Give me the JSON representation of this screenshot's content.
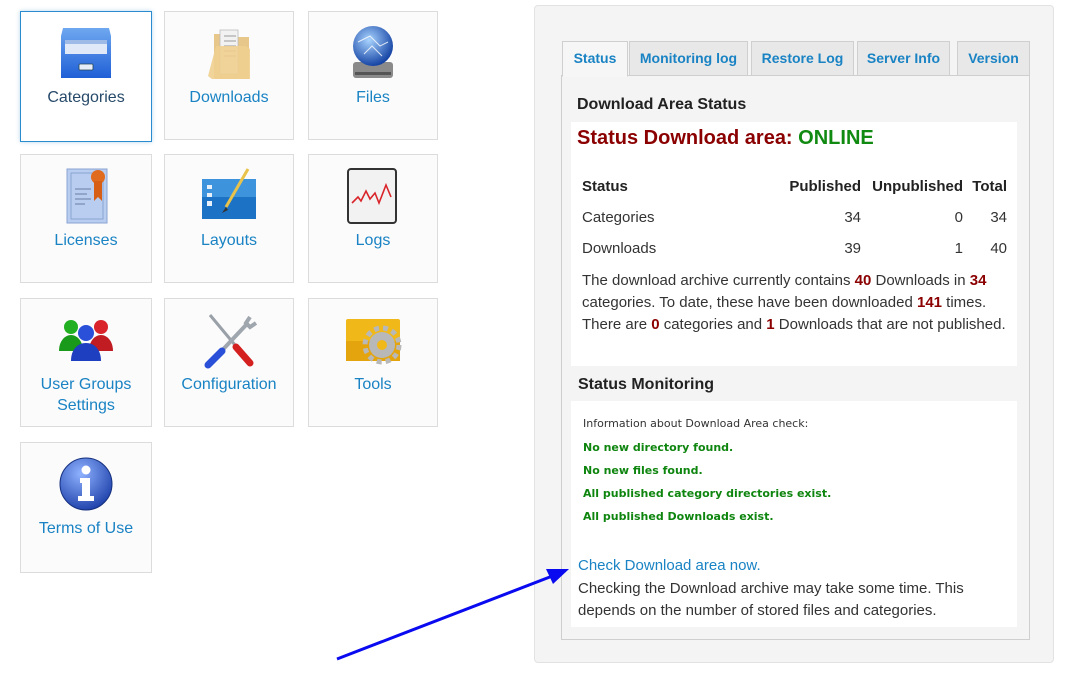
{
  "tiles": [
    {
      "label": "Categories",
      "icon": "file-cabinet-icon",
      "active": true
    },
    {
      "label": "Downloads",
      "icon": "folder-documents-icon"
    },
    {
      "label": "Files",
      "icon": "network-drive-globe-icon"
    },
    {
      "label": "Licenses",
      "icon": "certificate-icon"
    },
    {
      "label": "Layouts",
      "icon": "layout-brush-icon"
    },
    {
      "label": "Logs",
      "icon": "log-chart-icon"
    },
    {
      "label": "User Groups Settings",
      "label_line1": "User Groups",
      "label_line2": "Settings",
      "icon": "user-group-icon"
    },
    {
      "label": "Configuration",
      "icon": "tools-wrench-screwdriver-icon"
    },
    {
      "label": "Tools",
      "icon": "folder-gear-icon"
    },
    {
      "label": "Terms of Use",
      "icon": "info-icon"
    }
  ],
  "tabs": [
    {
      "label": "Status",
      "active": true
    },
    {
      "label": "Monitoring log"
    },
    {
      "label": "Restore Log"
    },
    {
      "label": "Server Info"
    },
    {
      "label": "Version"
    }
  ],
  "status": {
    "heading": "Download Area Status",
    "status_prefix": "Status Download area:",
    "status_value": "ONLINE",
    "table": {
      "headers": [
        "Status",
        "Published",
        "Unpublished",
        "Total"
      ],
      "rows": [
        [
          "Categories",
          "34",
          "0",
          "34"
        ],
        [
          "Downloads",
          "39",
          "1",
          "40"
        ]
      ]
    },
    "summary": {
      "t1": "The download archive currently contains ",
      "downloads_total": "40",
      "t2": " Downloads in ",
      "categories_total": "34",
      "t3": " categories. To date, these have been downloaded ",
      "download_count": "141",
      "t4": " times. There are ",
      "unpub_categories": "0",
      "t5": " categories and ",
      "unpub_downloads": "1",
      "t6": " Downloads that are not published."
    }
  },
  "monitoring": {
    "heading": "Status Monitoring",
    "info": "Information about Download Area check:",
    "messages": [
      "No new directory found.",
      "No new files found.",
      "All published category directories exist.",
      "All published Downloads exist."
    ],
    "check_link": "Check Download area now.",
    "note": "Checking the Download archive may take some time. This depends on the number of stored files and categories."
  },
  "colors": {
    "link": "#1a83c4",
    "status_red": "#8b0000",
    "online_green": "#118a11",
    "ok_green": "#0e850e",
    "annotation_arrow": "#0a0af0"
  }
}
